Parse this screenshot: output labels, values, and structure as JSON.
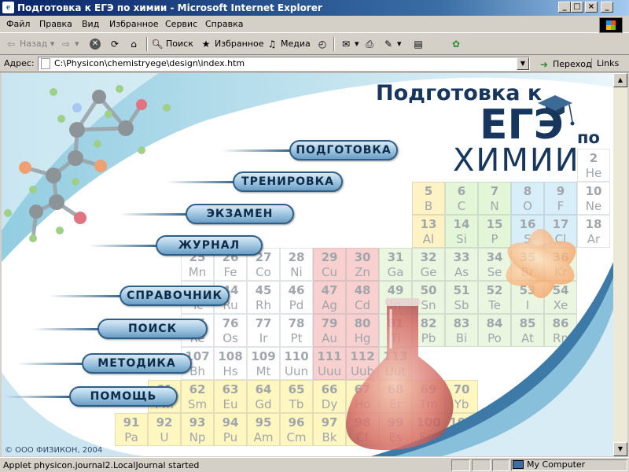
{
  "window": {
    "title": "Подготовка к ЕГЭ по химии - Microsoft Internet Explorer",
    "icon_glyph": "e",
    "controls": [
      "_",
      "□",
      "×",
      "_",
      "🗗",
      "×"
    ]
  },
  "menu": [
    "Файл",
    "Правка",
    "Вид",
    "Избранное",
    "Сервис",
    "Справка"
  ],
  "toolbar": {
    "back": "Назад",
    "search": "Поиск",
    "favorites": "Избранное",
    "media": "Медиа"
  },
  "address": {
    "label": "Адрес:",
    "value": "C:\\Physicon\\chemistryege\\design\\index.htm",
    "go": "Переход",
    "links": "Links"
  },
  "page": {
    "heading_line1": "Подготовка к",
    "heading_ege": "ЕГЭ",
    "heading_po": "по",
    "heading_chem": "ХИМИИ",
    "menu_items": [
      "ПОДГОТОВКА",
      "ТРЕНИРОВКА",
      "ЭКЗАМЕН",
      "ЖУРНАЛ",
      "СПРАВОЧНИК",
      "ПОИСК",
      "МЕТОДИКА",
      "ПОМОЩЬ"
    ],
    "copyright": "© ООО ФИЗИКОН, 2004",
    "periodic": [
      {
        "n": "2",
        "s": "He"
      },
      {
        "n": "5",
        "s": "B"
      },
      {
        "n": "6",
        "s": "C"
      },
      {
        "n": "7",
        "s": "N"
      },
      {
        "n": "8",
        "s": "O"
      },
      {
        "n": "9",
        "s": "F"
      },
      {
        "n": "10",
        "s": "Ne"
      },
      {
        "n": "13",
        "s": "Al"
      },
      {
        "n": "14",
        "s": "Si"
      },
      {
        "n": "15",
        "s": "P"
      },
      {
        "n": "16",
        "s": "S"
      },
      {
        "n": "17",
        "s": "Cl"
      },
      {
        "n": "18",
        "s": "Ar"
      },
      {
        "n": "25",
        "s": "Mn"
      },
      {
        "n": "26",
        "s": "Fe"
      },
      {
        "n": "27",
        "s": "Co"
      },
      {
        "n": "28",
        "s": "Ni"
      },
      {
        "n": "29",
        "s": "Cu"
      },
      {
        "n": "30",
        "s": "Zn"
      },
      {
        "n": "31",
        "s": "Ga"
      },
      {
        "n": "32",
        "s": "Ge"
      },
      {
        "n": "33",
        "s": "As"
      },
      {
        "n": "34",
        "s": "Se"
      },
      {
        "n": "35",
        "s": "Br"
      },
      {
        "n": "36",
        "s": "Kr"
      },
      {
        "n": "43",
        "s": "Tc"
      },
      {
        "n": "44",
        "s": "Ru"
      },
      {
        "n": "45",
        "s": "Rh"
      },
      {
        "n": "46",
        "s": "Pd"
      },
      {
        "n": "47",
        "s": "Ag"
      },
      {
        "n": "48",
        "s": "Cd"
      },
      {
        "n": "49",
        "s": "In"
      },
      {
        "n": "50",
        "s": "Sn"
      },
      {
        "n": "51",
        "s": "Sb"
      },
      {
        "n": "52",
        "s": "Te"
      },
      {
        "n": "53",
        "s": "I"
      },
      {
        "n": "54",
        "s": "Xe"
      },
      {
        "n": "75",
        "s": "Re"
      },
      {
        "n": "76",
        "s": "Os"
      },
      {
        "n": "77",
        "s": "Ir"
      },
      {
        "n": "78",
        "s": "Pt"
      },
      {
        "n": "79",
        "s": "Au"
      },
      {
        "n": "80",
        "s": "Hg"
      },
      {
        "n": "81",
        "s": "Tl"
      },
      {
        "n": "82",
        "s": "Pb"
      },
      {
        "n": "83",
        "s": "Bi"
      },
      {
        "n": "84",
        "s": "Po"
      },
      {
        "n": "85",
        "s": "At"
      },
      {
        "n": "86",
        "s": "Rn"
      },
      {
        "n": "107",
        "s": "Bh"
      },
      {
        "n": "108",
        "s": "Hs"
      },
      {
        "n": "109",
        "s": "Mt"
      },
      {
        "n": "110",
        "s": "Uun"
      },
      {
        "n": "111",
        "s": "Uuu"
      },
      {
        "n": "112",
        "s": "Uub"
      },
      {
        "n": "113",
        "s": "Uut"
      },
      {
        "n": "61",
        "s": "Pm"
      },
      {
        "n": "62",
        "s": "Sm"
      },
      {
        "n": "63",
        "s": "Eu"
      },
      {
        "n": "64",
        "s": "Gd"
      },
      {
        "n": "65",
        "s": "Tb"
      },
      {
        "n": "66",
        "s": "Dy"
      },
      {
        "n": "67",
        "s": "Ho"
      },
      {
        "n": "68",
        "s": "Er"
      },
      {
        "n": "69",
        "s": "Tm"
      },
      {
        "n": "70",
        "s": "Yb"
      },
      {
        "n": "91",
        "s": "Pa"
      },
      {
        "n": "92",
        "s": "U"
      },
      {
        "n": "93",
        "s": "Np"
      },
      {
        "n": "94",
        "s": "Pu"
      },
      {
        "n": "95",
        "s": "Am"
      },
      {
        "n": "96",
        "s": "Cm"
      },
      {
        "n": "97",
        "s": "Bk"
      },
      {
        "n": "98",
        "s": "Cf"
      },
      {
        "n": "99",
        "s": "Es"
      },
      {
        "n": "100",
        "s": "Fm"
      },
      {
        "n": "101",
        "s": "Md"
      }
    ]
  },
  "status": {
    "text": "Applet physicon.journal2.LocalJournal started",
    "zone": "My Computer"
  }
}
